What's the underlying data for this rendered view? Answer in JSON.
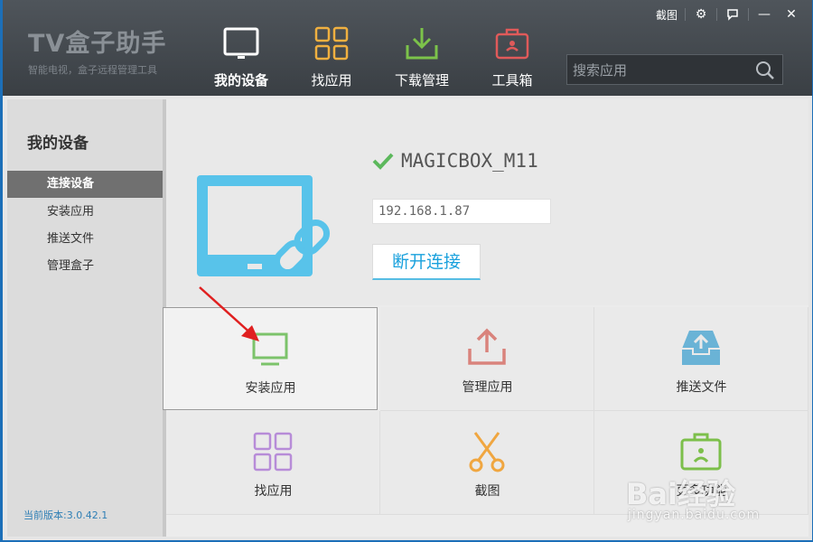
{
  "app": {
    "logo_title": "TV盒子助手",
    "logo_subtitle": "智能电视，盒子远程管理工具"
  },
  "window_controls": {
    "screenshot_label": "截图"
  },
  "nav": [
    {
      "label": "我的设备",
      "icon": "tv-icon",
      "active": true
    },
    {
      "label": "找应用",
      "icon": "apps-grid-icon",
      "active": false
    },
    {
      "label": "下载管理",
      "icon": "download-icon",
      "active": false
    },
    {
      "label": "工具箱",
      "icon": "toolbox-icon",
      "active": false
    }
  ],
  "search": {
    "placeholder": "搜索应用"
  },
  "sidebar": {
    "title": "我的设备",
    "items": [
      {
        "label": "连接设备",
        "active": true
      },
      {
        "label": "安装应用",
        "active": false
      },
      {
        "label": "推送文件",
        "active": false
      },
      {
        "label": "管理盒子",
        "active": false
      }
    ],
    "version": "当前版本:3.0.42.1"
  },
  "device": {
    "name": "MAGICBOX_M11",
    "ip": "192.168.1.87",
    "disconnect_label": "断开连接"
  },
  "tiles": [
    {
      "label": "安装应用",
      "icon": "monitor-icon",
      "color": "#7cc36b"
    },
    {
      "label": "管理应用",
      "icon": "upload-icon",
      "color": "#d9837c"
    },
    {
      "label": "推送文件",
      "icon": "inbox-upload-icon",
      "color": "#6ab3d6"
    },
    {
      "label": "找应用",
      "icon": "apps-grid-icon",
      "color": "#b78cd8"
    },
    {
      "label": "截图",
      "icon": "scissors-icon",
      "color": "#f0a640"
    },
    {
      "label": "更多功能",
      "icon": "briefcase-icon",
      "color": "#7cbf4a"
    }
  ],
  "watermark": {
    "text": "Bai经验",
    "url_text": "jingyan.baidu.com"
  },
  "colors": {
    "titlebar": "#43484d",
    "accent": "#1aa1dd",
    "check": "#5cb85c",
    "sidebar_active": "#707070"
  }
}
